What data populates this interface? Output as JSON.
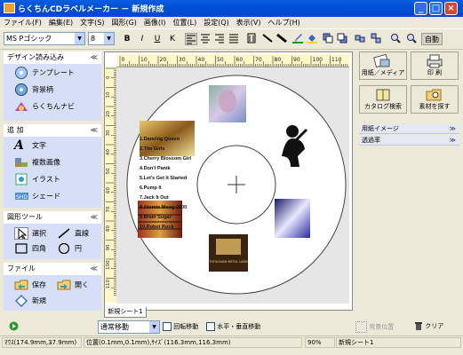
{
  "window": {
    "title": "らくちんCDラベルメーカー － 新規作成",
    "controls": {
      "minimize": "_",
      "maximize": "□",
      "close": "×"
    }
  },
  "menu": [
    "ファイル(F)",
    "編集(E)",
    "文字(S)",
    "図形(G)",
    "画像(I)",
    "位置(L)",
    "設定(Q)",
    "表示(V)",
    "ヘルプ(H)"
  ],
  "toolbar": {
    "font": "MS Pゴシック",
    "size": "8",
    "bold": "B",
    "italic": "I",
    "underline": "U",
    "outline": "K",
    "auto": "自動"
  },
  "left_panel": {
    "design": {
      "header": "デザイン読み込み",
      "items": [
        "テンプレート",
        "背景柄",
        "らくちんナビ"
      ]
    },
    "add": {
      "header": "追 加",
      "items": [
        "文字",
        "複数画像",
        "イラスト",
        "シェード"
      ]
    },
    "tools": {
      "header": "図形ツール",
      "items": [
        "選択",
        "直線",
        "四角",
        "円"
      ]
    },
    "file": {
      "header": "ファイル",
      "items": [
        "保存",
        "開く",
        "新規"
      ]
    }
  },
  "ruler": {
    "h_labels": [
      "0",
      "10",
      "20",
      "30",
      "40",
      "50",
      "60",
      "70",
      "80",
      "90",
      "100",
      "110"
    ],
    "v_labels": [
      "0",
      "10",
      "20",
      "30",
      "40",
      "50",
      "60",
      "70",
      "80",
      "90",
      "100",
      "110"
    ]
  },
  "disc": {
    "tracklist": [
      "1.Dancing Queen",
      "2.The Girls",
      "3.Cherry Blossom Girl",
      "4.Don't Panik",
      "5.Let's Get It Started",
      "6.Pump It",
      "7.Jack It Out",
      "8.Atomic Moog 2000",
      "9.Brain Sugar",
      "10.Robot Rock"
    ],
    "art_text": "THOUSAND METAL LAND"
  },
  "right_panel": {
    "buttons": [
      "用紙／メディア",
      "印 刷",
      "カタログ検索",
      "素材を探す"
    ],
    "sections": [
      "用紙イメージ",
      "透過率"
    ]
  },
  "bottom": {
    "sheet_tab": "新規シート1",
    "move_mode": "通常移動",
    "checkbox_rotate": "回転移動",
    "checkbox_hv": "水平・垂直移動",
    "bg_position": "背景位置",
    "clear": "クリア"
  },
  "status": {
    "mouse": "ﾏｳｽ(174.9mm,37.9mm)",
    "position": "位置(0.1mm,0.1mm),ｻｲｽﾞ(116.3mm,116.3mm)",
    "zoom": "90%",
    "sheet": "新規シート1"
  },
  "colors": {
    "titlebar": "#0050D8",
    "panel_body": "#D6DFF7",
    "ruler": "#FFF7C8"
  }
}
